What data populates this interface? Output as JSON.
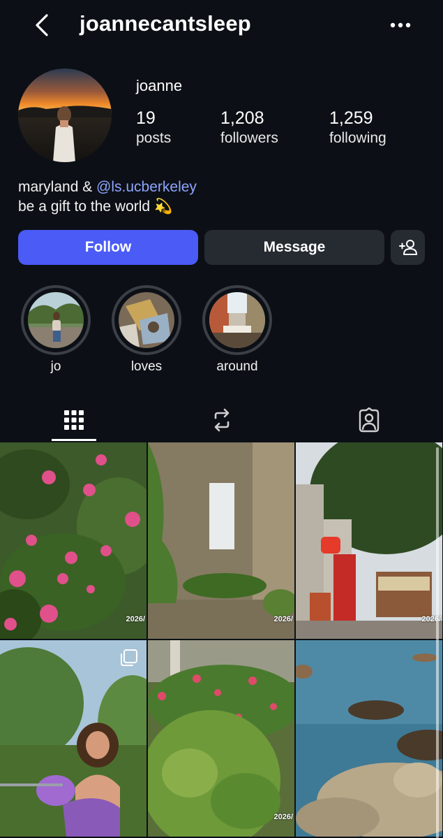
{
  "header": {
    "username": "joannecantsleep",
    "back_icon": "chevron-left-icon",
    "more_icon": "more-horizontal-icon"
  },
  "profile": {
    "display_name": "joanne",
    "stats": {
      "posts_count": "19",
      "posts_label": "posts",
      "followers_count": "1,208",
      "followers_label": "followers",
      "following_count": "1,259",
      "following_label": "following"
    },
    "bio": {
      "line1_prefix": "maryland & ",
      "line1_mention": "@ls.ucberkeley",
      "line2": "be a gift to the world 💫"
    }
  },
  "actions": {
    "follow_label": "Follow",
    "message_label": "Message",
    "add_user_icon": "add-user-icon"
  },
  "highlights": [
    {
      "label": "jo"
    },
    {
      "label": "loves"
    },
    {
      "label": "around"
    }
  ],
  "tabs": [
    {
      "icon": "grid-icon",
      "selected": true
    },
    {
      "icon": "reposts-icon",
      "selected": false
    },
    {
      "icon": "tagged-icon",
      "selected": false
    }
  ],
  "posts": [
    {
      "subject": "pink flowers",
      "label": "2026/"
    },
    {
      "subject": "ruins with ivy",
      "label": "2026/"
    },
    {
      "subject": "cable car street",
      "label": "2026/"
    },
    {
      "subject": "girl with lilacs",
      "label": "",
      "multi": true
    },
    {
      "subject": "garden flowers",
      "label": "2026/"
    },
    {
      "subject": "bay rocks",
      "label": ""
    }
  ],
  "colors": {
    "background": "#0c1016",
    "follow_button": "#4a5bf6",
    "secondary_button": "#262a31",
    "mention": "#8ea5ff"
  }
}
